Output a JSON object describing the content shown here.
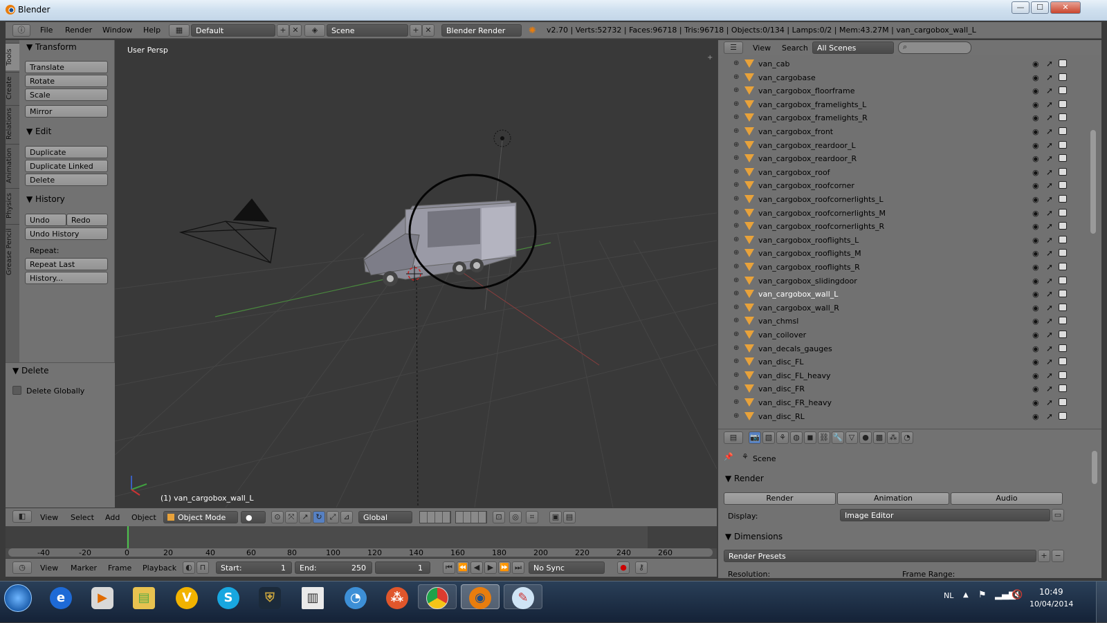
{
  "window": {
    "title": "Blender",
    "min": "—",
    "max": "☐",
    "close": "✕"
  },
  "topbar": {
    "menus": [
      "File",
      "Render",
      "Window",
      "Help"
    ],
    "layout": "Default",
    "scene": "Scene",
    "engine": "Blender Render",
    "stats": "v2.70 | Verts:52732 | Faces:96718 | Tris:96718 | Objects:0/134 | Lamps:0/2 | Mem:43.27M | van_cargobox_wall_L"
  },
  "toolshelf": {
    "tabs": [
      "Tools",
      "Create",
      "Relations",
      "Animation",
      "Physics",
      "Grease Pencil"
    ],
    "transform": {
      "header": "Transform",
      "buttons": [
        "Translate",
        "Rotate",
        "Scale",
        "Mirror"
      ]
    },
    "edit": {
      "header": "Edit",
      "buttons": [
        "Duplicate",
        "Duplicate Linked",
        "Delete"
      ]
    },
    "history": {
      "header": "History",
      "undo": "Undo",
      "redo": "Redo",
      "undo_history": "Undo History",
      "repeat_label": "Repeat:",
      "repeat_last": "Repeat Last",
      "history": "History..."
    },
    "delete_panel": {
      "header": "Delete",
      "checkbox": "Delete Globally"
    }
  },
  "viewport": {
    "label": "User Persp",
    "object_label": "(1) van_cargobox_wall_L"
  },
  "viewport_header": {
    "menus": [
      "View",
      "Select",
      "Add",
      "Object"
    ],
    "mode": "Object Mode",
    "orientation": "Global"
  },
  "timeline": {
    "ticks": [
      "-40",
      "-20",
      "0",
      "20",
      "40",
      "60",
      "80",
      "100",
      "120",
      "140",
      "160",
      "180",
      "200",
      "220",
      "240",
      "260"
    ]
  },
  "timeline_header": {
    "menus": [
      "View",
      "Marker",
      "Frame",
      "Playback"
    ],
    "start": "Start:",
    "start_val": "1",
    "end": "End:",
    "end_val": "250",
    "current": "1",
    "sync": "No Sync"
  },
  "outliner": {
    "menus": [
      "View",
      "Search"
    ],
    "filter": "All Scenes",
    "items": [
      "van_cab",
      "van_cargobase",
      "van_cargobox_floorframe",
      "van_cargobox_framelights_L",
      "van_cargobox_framelights_R",
      "van_cargobox_front",
      "van_cargobox_reardoor_L",
      "van_cargobox_reardoor_R",
      "van_cargobox_roof",
      "van_cargobox_roofcorner",
      "van_cargobox_roofcornerlights_L",
      "van_cargobox_roofcornerlights_M",
      "van_cargobox_roofcornerlights_R",
      "van_cargobox_rooflights_L",
      "van_cargobox_rooflights_M",
      "van_cargobox_rooflights_R",
      "van_cargobox_slidingdoor",
      "van_cargobox_wall_L",
      "van_cargobox_wall_R",
      "van_chmsl",
      "van_coilover",
      "van_decals_gauges",
      "van_disc_FL",
      "van_disc_FL_heavy",
      "van_disc_FR",
      "van_disc_FR_heavy",
      "van_disc_RL"
    ],
    "selected": "van_cargobox_wall_L"
  },
  "properties": {
    "context": "Scene",
    "render_header": "Render",
    "render_btn": "Render",
    "animation_btn": "Animation",
    "audio_btn": "Audio",
    "display_label": "Display:",
    "display_value": "Image Editor",
    "dimensions_header": "Dimensions",
    "presets": "Render Presets",
    "resolution": "Resolution:",
    "frame_range": "Frame Range:"
  },
  "taskbar": {
    "lang": "NL",
    "time": "10:49",
    "date": "10/04/2014"
  }
}
